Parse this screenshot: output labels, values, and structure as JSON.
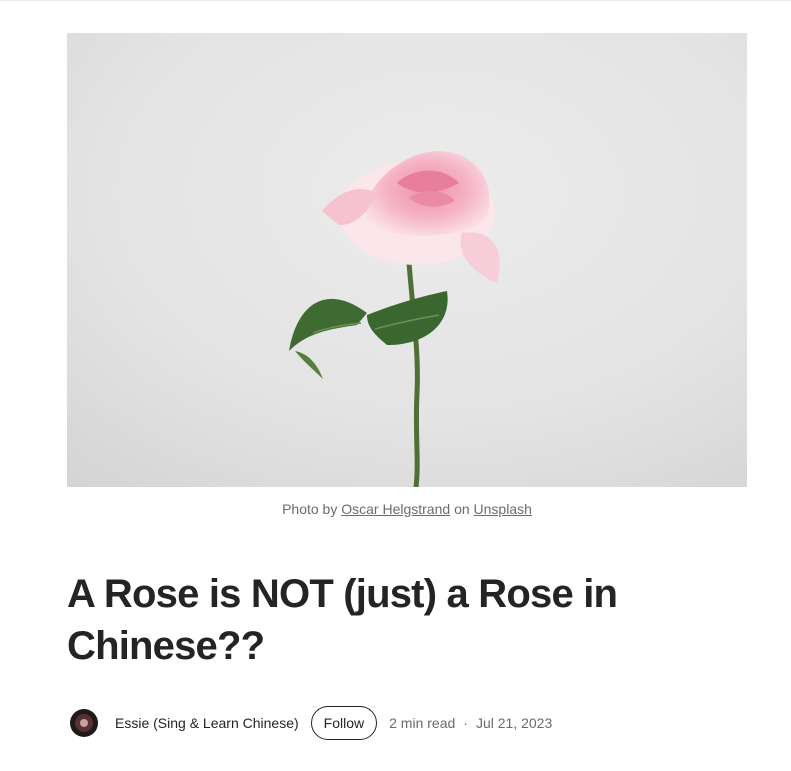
{
  "hero": {
    "image_alt": "pink rose on grey background",
    "colors": {
      "background": "#e6e6e6",
      "petal": "#f4aec0",
      "leaf": "#3e6b32",
      "stem": "#4a6d35"
    }
  },
  "caption": {
    "prefix": "Photo by",
    "author_link": "Oscar Helgstrand",
    "middle": "on",
    "site_link": "Unsplash"
  },
  "article": {
    "title": "A Rose is NOT (just) a Rose in Chinese??"
  },
  "byline": {
    "author": "Essie (Sing & Learn Chinese)",
    "follow_label": "Follow",
    "read_time": "2 min read",
    "separator": "·",
    "date": "Jul 21, 2023"
  }
}
